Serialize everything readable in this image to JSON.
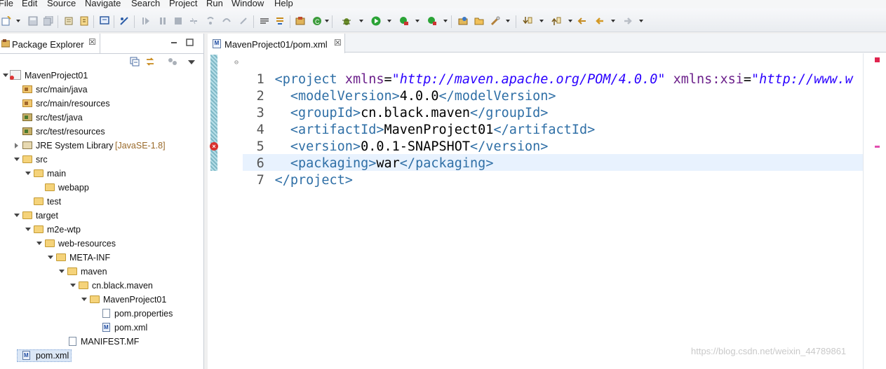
{
  "menubar": {
    "items": [
      "File",
      "Edit",
      "Source",
      "Navigate",
      "Search",
      "Project",
      "Run",
      "Window",
      "Help"
    ]
  },
  "package_explorer": {
    "title": "Package Explorer",
    "close_glyph": "☒",
    "tree": [
      {
        "label": "MavenProject01",
        "decor": ""
      },
      {
        "label": "src/main/java",
        "decor": ""
      },
      {
        "label": "src/main/resources",
        "decor": ""
      },
      {
        "label": "src/test/java",
        "decor": ""
      },
      {
        "label": "src/test/resources",
        "decor": ""
      },
      {
        "label": "JRE System Library",
        "decor": "[JavaSE-1.8]"
      },
      {
        "label": "src",
        "decor": ""
      },
      {
        "label": "main",
        "decor": ""
      },
      {
        "label": "webapp",
        "decor": ""
      },
      {
        "label": "test",
        "decor": ""
      },
      {
        "label": "target",
        "decor": ""
      },
      {
        "label": "m2e-wtp",
        "decor": ""
      },
      {
        "label": "web-resources",
        "decor": ""
      },
      {
        "label": "META-INF",
        "decor": ""
      },
      {
        "label": "maven",
        "decor": ""
      },
      {
        "label": "cn.black.maven",
        "decor": ""
      },
      {
        "label": "MavenProject01",
        "decor": ""
      },
      {
        "label": "pom.properties",
        "decor": ""
      },
      {
        "label": "pom.xml",
        "decor": ""
      },
      {
        "label": "MANIFEST.MF",
        "decor": ""
      },
      {
        "label": "pom.xml",
        "decor": ""
      }
    ]
  },
  "editor": {
    "tab_title": "MavenProject01/pom.xml",
    "tab_icon": "M",
    "close_glyph": "☒",
    "error_glyph": "×",
    "lines": [
      {
        "num": "1",
        "tag_open": "<project ",
        "attr1": "xmlns",
        "eq1": "=",
        "val1": "\"http://maven.apache.org/POM/4.0.0\"",
        "sp": " ",
        "attr2": "xmlns:xsi",
        "eq2": "=",
        "val2": "\"http://www.w"
      },
      {
        "num": "2",
        "open": "<modelVersion>",
        "text": "4.0.0",
        "close": "</modelVersion>"
      },
      {
        "num": "3",
        "open": "<groupId>",
        "text": "cn.black.maven",
        "close": "</groupId>"
      },
      {
        "num": "4",
        "open": "<artifactId>",
        "text": "MavenProject01",
        "close": "</artifactId>"
      },
      {
        "num": "5",
        "open": "<version>",
        "text": "0.0.1-SNAPSHOT",
        "close": "</version>"
      },
      {
        "num": "6",
        "open": "<packaging>",
        "text": "war",
        "close": "</packaging>"
      },
      {
        "num": "7",
        "close": "</project>"
      }
    ]
  },
  "watermark": "https://blog.csdn.net/weixin_44789861",
  "colors": {
    "tag": "#2f6fa6",
    "attribute": "#6b1f8a",
    "value": "#2a00ff",
    "selection": "#dbe7f6",
    "current_line": "#e8f2fe",
    "error": "#d8322f"
  },
  "icons": {
    "toolbar": [
      "new-icon",
      "save-icon",
      "save-all-icon",
      "print-icon",
      "debug-icon",
      "run-icon",
      "external-tools-icon",
      "open-type-icon",
      "search-icon",
      "back-icon",
      "forward-icon"
    ],
    "view": [
      "collapse-all-icon",
      "link-with-editor-icon",
      "focus-icon",
      "view-menu-icon",
      "minimize-icon",
      "maximize-icon"
    ]
  }
}
